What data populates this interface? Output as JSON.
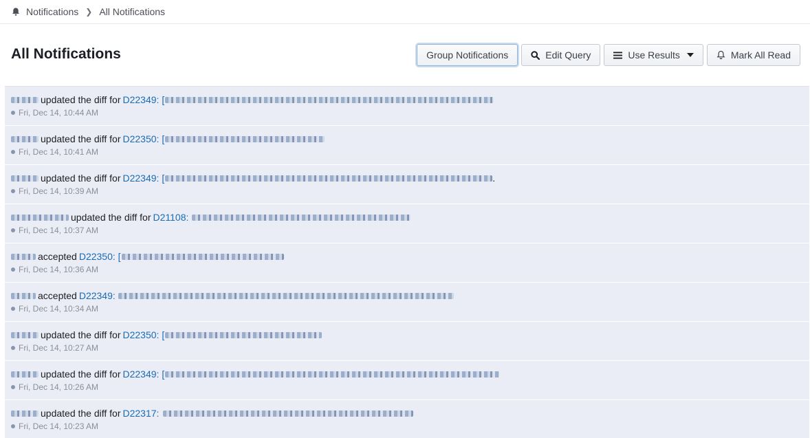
{
  "breadcrumb": {
    "icon": "bell-icon",
    "root": "Notifications",
    "current": "All Notifications"
  },
  "header": {
    "title": "All Notifications"
  },
  "toolbar": {
    "group_label": "Group Notifications",
    "edit_query_label": "Edit Query",
    "use_results_label": "Use Results",
    "mark_all_read_label": "Mark All Read"
  },
  "notifications": [
    {
      "verb": "updated the diff for",
      "object": "D22349: [",
      "tail": "",
      "time": "Fri, Dec 14, 10:44 AM"
    },
    {
      "verb": "updated the diff for",
      "object": "D22350: [",
      "tail": "",
      "time": "Fri, Dec 14, 10:41 AM"
    },
    {
      "verb": "updated the diff for",
      "object": "D22349: [",
      "tail": ".",
      "time": "Fri, Dec 14, 10:39 AM"
    },
    {
      "verb": "updated the diff for",
      "object": "D21108:",
      "tail": "",
      "time": "Fri, Dec 14, 10:37 AM"
    },
    {
      "verb": "accepted",
      "object": "D22350: [",
      "tail": "",
      "time": "Fri, Dec 14, 10:36 AM"
    },
    {
      "verb": "accepted",
      "object": "D22349:",
      "tail": "",
      "time": "Fri, Dec 14, 10:34 AM"
    },
    {
      "verb": "updated the diff for",
      "object": "D22350: [",
      "tail": "",
      "time": "Fri, Dec 14, 10:27 AM"
    },
    {
      "verb": "updated the diff for",
      "object": "D22349: [",
      "tail": "",
      "time": "Fri, Dec 14, 10:26 AM"
    },
    {
      "verb": "updated the diff for",
      "object": "D22317:",
      "tail": "",
      "time": "Fri, Dec 14, 10:23 AM"
    }
  ]
}
